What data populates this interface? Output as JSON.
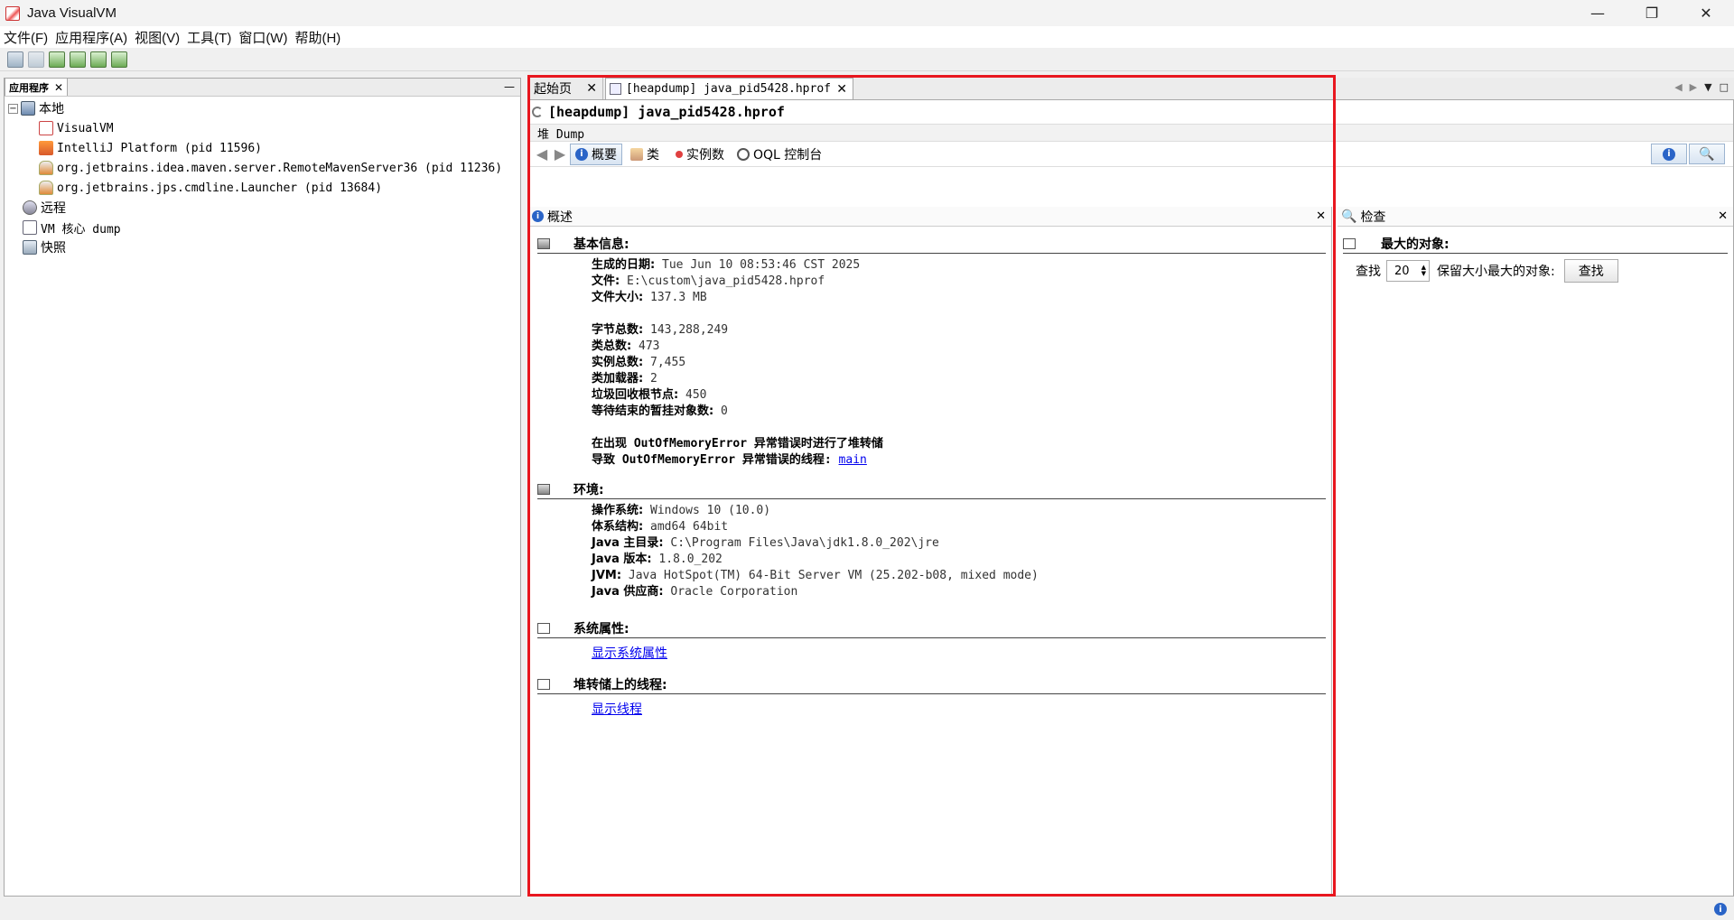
{
  "window": {
    "title": "Java VisualVM",
    "controls": [
      "—",
      "❐",
      "✕"
    ]
  },
  "menu": [
    "文件(F)",
    "应用程序(A)",
    "视图(V)",
    "工具(T)",
    "窗口(W)",
    "帮助(H)"
  ],
  "left_panel": {
    "tab_label": "应用程序",
    "tree": {
      "local": "本地",
      "local_children": [
        "VisualVM",
        "IntelliJ Platform (pid 11596)",
        "org.jetbrains.idea.maven.server.RemoteMavenServer36 (pid 11236)",
        "org.jetbrains.jps.cmdline.Launcher (pid 13684)"
      ],
      "remote": "远程",
      "vm_core_dump": "VM 核心 dump",
      "snapshots": "快照"
    }
  },
  "tabs": {
    "start_page": "起始页",
    "heapdump": "[heapdump] java_pid5428.hprof"
  },
  "heading": "[heapdump] java_pid5428.hprof",
  "subbar": "堆 Dump",
  "views": {
    "summary": "概要",
    "classes": "类",
    "instances": "实例数",
    "oql": "OQL 控制台"
  },
  "overview": {
    "title": "概述",
    "basic": {
      "title": "基本信息:",
      "date_k": "生成的日期:",
      "date_v": "Tue Jun 10 08:53:46 CST 2025",
      "file_k": "文件:",
      "file_v": "E:\\custom\\java_pid5428.hprof",
      "size_k": "文件大小:",
      "size_v": "137.3 MB",
      "bytes_k": "字节总数:",
      "bytes_v": "143,288,249",
      "classes_k": "类总数:",
      "classes_v": "473",
      "inst_k": "实例总数:",
      "inst_v": "7,455",
      "loaders_k": "类加载器:",
      "loaders_v": "2",
      "gcroots_k": "垃圾回收根节点:",
      "gcroots_v": "450",
      "pending_k": "等待结束的暂挂对象数:",
      "pending_v": "0",
      "oom_line": "在出现 OutOfMemoryError 异常错误时进行了堆转储",
      "oom_thread_k": "导致 OutOfMemoryError 异常错误的线程:",
      "oom_thread_v": "main"
    },
    "env": {
      "title": "环境:",
      "os_k": "操作系统:",
      "os_v": "Windows 10 (10.0)",
      "arch_k": "体系结构:",
      "arch_v": "amd64 64bit",
      "home_k": "Java 主目录:",
      "home_v": "C:\\Program Files\\Java\\jdk1.8.0_202\\jre",
      "ver_k": "Java 版本:",
      "ver_v": "1.8.0_202",
      "jvm_k": "JVM:",
      "jvm_v": "Java HotSpot(TM) 64-Bit Server VM (25.202-b08, mixed mode)",
      "vendor_k": "Java 供应商:",
      "vendor_v": "Oracle Corporation"
    },
    "sysprops": {
      "title": "系统属性:",
      "link": "显示系统属性"
    },
    "threads": {
      "title": "堆转储上的线程:",
      "link": "显示线程"
    }
  },
  "inspect": {
    "title": "检查",
    "section": "最大的对象:",
    "find_label": "查找",
    "count": "20",
    "suffix": "保留大小最大的对象:",
    "button": "查找"
  },
  "colors": {
    "highlight_border": "#e8171f",
    "link": "#0000ee",
    "accent": "#2a64c7"
  }
}
